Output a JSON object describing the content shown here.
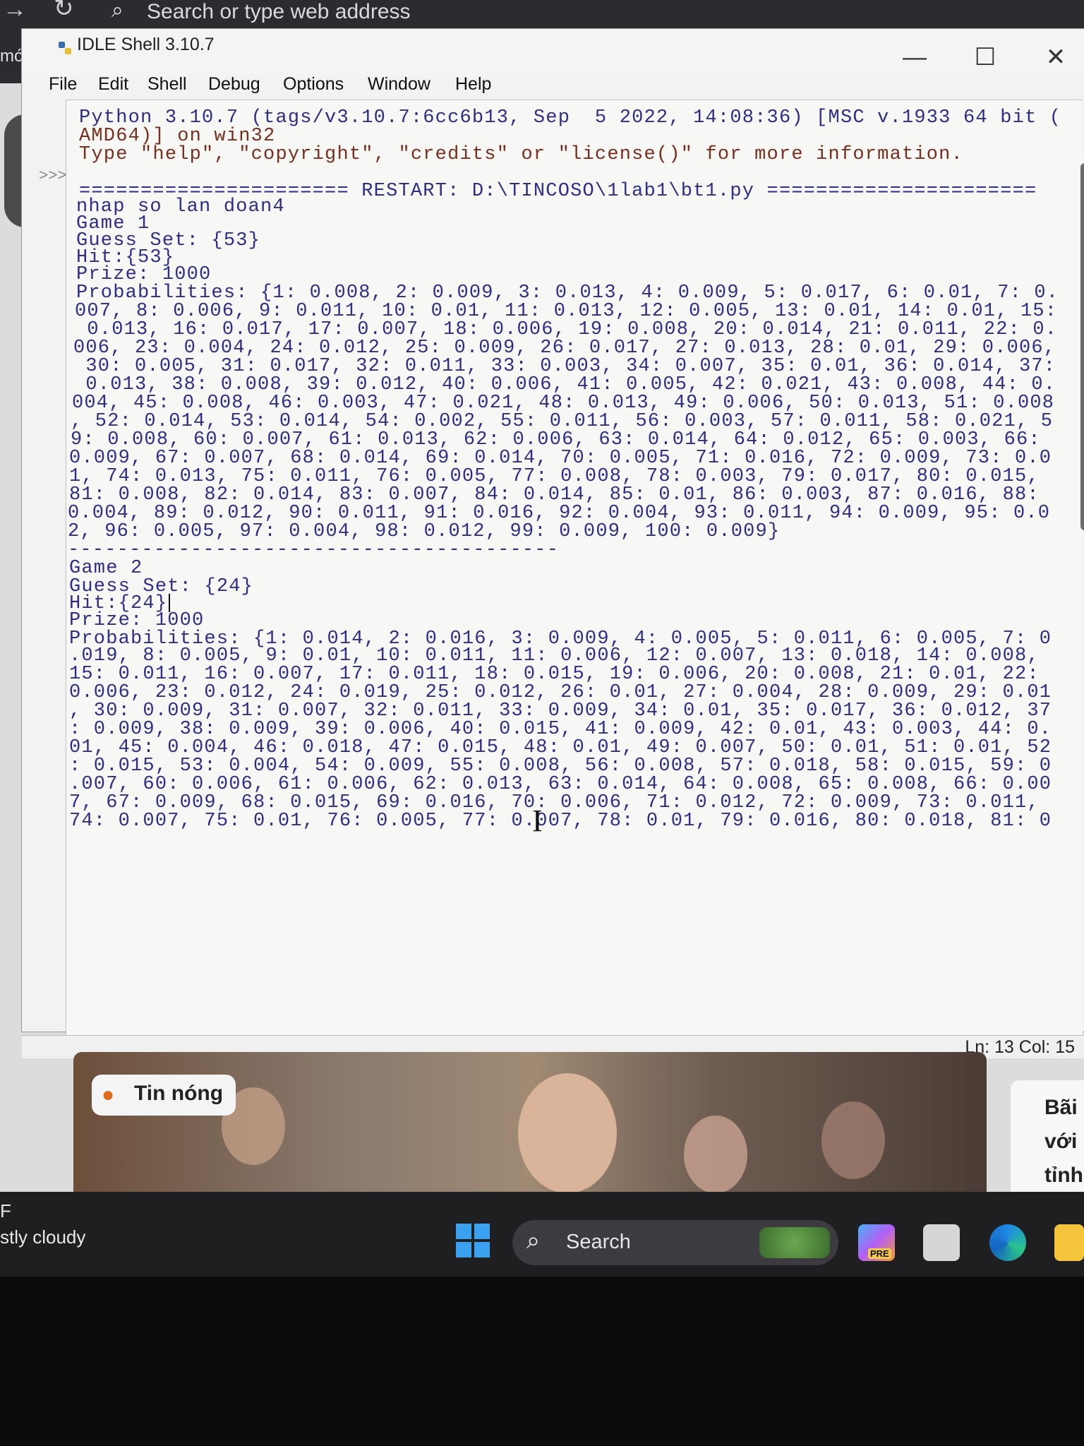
{
  "browser": {
    "address_placeholder": "Search or type web address",
    "side_label": "mới"
  },
  "window": {
    "title": "IDLE Shell 3.10.7",
    "minimize": "—",
    "maximize": "☐",
    "close": "✕"
  },
  "menu": [
    "File",
    "Edit",
    "Shell",
    "Debug",
    "Options",
    "Window",
    "Help"
  ],
  "shell": {
    "prompt": ">>>",
    "lines": [
      "Python 3.10.7 (tags/v3.10.7:6cc6b13, Sep  5 2022, 14:08:36) [MSC v.1933 64 bit (",
      "AMD64)] on win32",
      "Type \"help\", \"copyright\", \"credits\" or \"license()\" for more information.",
      "====================== RESTART: D:\\TINCOSO\\1lab1\\bt1.py ======================",
      "nhap so lan doan4",
      "Game 1",
      "Guess Set: {53}",
      "Hit:{53}",
      "Prize: 1000",
      "Probabilities: {1: 0.008, 2: 0.009, 3: 0.013, 4: 0.009, 5: 0.017, 6: 0.01, 7: 0.",
      "007, 8: 0.006, 9: 0.011, 10: 0.01, 11: 0.013, 12: 0.005, 13: 0.01, 14: 0.01, 15:",
      " 0.013, 16: 0.017, 17: 0.007, 18: 0.006, 19: 0.008, 20: 0.014, 21: 0.011, 22: 0.",
      "006, 23: 0.004, 24: 0.012, 25: 0.009, 26: 0.017, 27: 0.013, 28: 0.01, 29: 0.006,",
      " 30: 0.005, 31: 0.017, 32: 0.011, 33: 0.003, 34: 0.007, 35: 0.01, 36: 0.014, 37:",
      " 0.013, 38: 0.008, 39: 0.012, 40: 0.006, 41: 0.005, 42: 0.021, 43: 0.008, 44: 0.",
      "004, 45: 0.008, 46: 0.003, 47: 0.021, 48: 0.013, 49: 0.006, 50: 0.013, 51: 0.008",
      ", 52: 0.014, 53: 0.014, 54: 0.002, 55: 0.011, 56: 0.003, 57: 0.011, 58: 0.021, 5",
      "9: 0.008, 60: 0.007, 61: 0.013, 62: 0.006, 63: 0.014, 64: 0.012, 65: 0.003, 66:",
      "0.009, 67: 0.007, 68: 0.014, 69: 0.014, 70: 0.005, 71: 0.016, 72: 0.009, 73: 0.0",
      "1, 74: 0.013, 75: 0.011, 76: 0.005, 77: 0.008, 78: 0.003, 79: 0.017, 80: 0.015,",
      "81: 0.008, 82: 0.014, 83: 0.007, 84: 0.014, 85: 0.01, 86: 0.003, 87: 0.016, 88:",
      "0.004, 89: 0.012, 90: 0.011, 91: 0.016, 92: 0.004, 93: 0.011, 94: 0.009, 95: 0.0",
      "2, 96: 0.005, 97: 0.004, 98: 0.012, 99: 0.009, 100: 0.009}",
      "----------------------------------------",
      "Game 2",
      "Guess Set: {24}",
      "Hit:{24}",
      "Prize: 1000",
      "Probabilities: {1: 0.014, 2: 0.016, 3: 0.009, 4: 0.005, 5: 0.011, 6: 0.005, 7: 0",
      ".019, 8: 0.005, 9: 0.01, 10: 0.011, 11: 0.006, 12: 0.007, 13: 0.018, 14: 0.008,",
      "15: 0.011, 16: 0.007, 17: 0.011, 18: 0.015, 19: 0.006, 20: 0.008, 21: 0.01, 22:",
      "0.006, 23: 0.012, 24: 0.019, 25: 0.012, 26: 0.01, 27: 0.004, 28: 0.009, 29: 0.01",
      ", 30: 0.009, 31: 0.007, 32: 0.011, 33: 0.009, 34: 0.01, 35: 0.017, 36: 0.012, 37",
      ": 0.009, 38: 0.009, 39: 0.006, 40: 0.015, 41: 0.009, 42: 0.01, 43: 0.003, 44: 0.",
      "01, 45: 0.004, 46: 0.018, 47: 0.015, 48: 0.01, 49: 0.007, 50: 0.01, 51: 0.01, 52",
      ": 0.015, 53: 0.004, 54: 0.009, 55: 0.008, 56: 0.008, 57: 0.018, 58: 0.015, 59: 0",
      ".007, 60: 0.006, 61: 0.006, 62: 0.013, 63: 0.014, 64: 0.008, 65: 0.008, 66: 0.00",
      "7, 67: 0.009, 68: 0.015, 69: 0.016, 70: 0.006, 71: 0.012, 72: 0.009, 73: 0.011,",
      "74: 0.007, 75: 0.01, 76: 0.005, 77: 0.007, 78: 0.01, 79: 0.016, 80: 0.018, 81: 0"
    ]
  },
  "status": {
    "position": "Ln: 13  Col: 15"
  },
  "news": {
    "tag": "Tin nóng",
    "right_card": [
      "Bãi",
      "với",
      "tỉnh"
    ]
  },
  "taskbar": {
    "weather_temp": "F",
    "weather_text": "stly cloudy",
    "search_label": "Search",
    "copilot_badge": "PRE"
  }
}
